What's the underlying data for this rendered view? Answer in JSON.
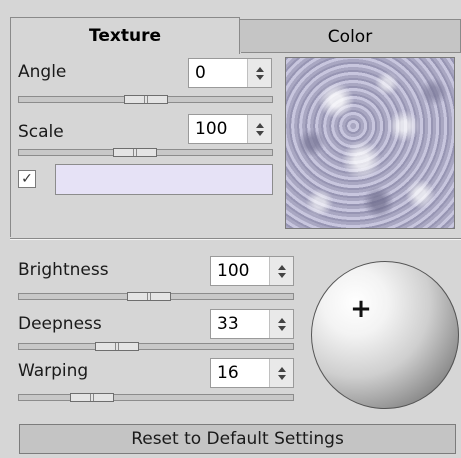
{
  "tabs": {
    "texture": "Texture",
    "color": "Color"
  },
  "texture_panel": {
    "angle": {
      "label": "Angle",
      "value": "0",
      "slider_fraction": 0.5
    },
    "scale": {
      "label": "Scale",
      "value": "100",
      "slider_fraction": 0.45
    },
    "checkbox_checked": true,
    "checkbox_glyph": "✓",
    "swatch_color": "#e6e2f6",
    "preview_icon": "texture-preview-image"
  },
  "adjust_panel": {
    "brightness": {
      "label": "Brightness",
      "value": "100",
      "slider_fraction": 0.47
    },
    "deepness": {
      "label": "Deepness",
      "value": "33",
      "slider_fraction": 0.33
    },
    "warping": {
      "label": "Warping",
      "value": "16",
      "slider_fraction": 0.22
    },
    "sphere_icon": "light-direction-sphere",
    "plus_glyph": "+"
  },
  "reset_button": "Reset to Default Settings",
  "colors": {
    "background": "#d6d6d6",
    "swatch": "#e6e2f6"
  }
}
